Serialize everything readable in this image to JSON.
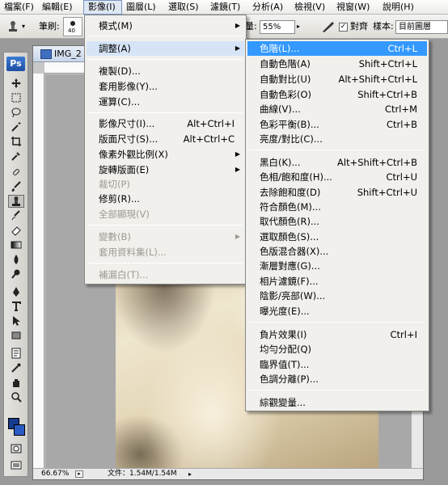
{
  "menubar": {
    "items": [
      {
        "label": "檔案(F)"
      },
      {
        "label": "編輯(E)"
      },
      {
        "label": "影像(I)"
      },
      {
        "label": "圖層(L)"
      },
      {
        "label": "選取(S)"
      },
      {
        "label": "濾鏡(T)"
      },
      {
        "label": "分析(A)"
      },
      {
        "label": "檢視(V)"
      },
      {
        "label": "視窗(W)"
      },
      {
        "label": "說明(H)"
      }
    ]
  },
  "options": {
    "brush_label": "筆刷:",
    "brush_size": "40",
    "flow_label": "流量:",
    "flow_value": "55%",
    "align_label": "對齊",
    "align_checked": "✓",
    "sample_label": "樣本:",
    "sample_value": "目前圖層"
  },
  "toolbox": {
    "logo": "Ps"
  },
  "document": {
    "title": "IMG_2",
    "zoom": "66.67%",
    "file_info": "文件：1.54M/1.54M"
  },
  "image_menu": {
    "items": [
      {
        "label": "模式(M)",
        "shortcut": "",
        "arrow": "▶"
      },
      {
        "label": "調整(A)",
        "shortcut": "",
        "arrow": "▶"
      },
      {
        "label": "複製(D)...",
        "shortcut": "",
        "arrow": ""
      },
      {
        "label": "套用影像(Y)...",
        "shortcut": "",
        "arrow": ""
      },
      {
        "label": "運算(C)...",
        "shortcut": "",
        "arrow": ""
      },
      {
        "label": "影像尺寸(I)...",
        "shortcut": "Alt+Ctrl+I",
        "arrow": ""
      },
      {
        "label": "版面尺寸(S)...",
        "shortcut": "Alt+Ctrl+C",
        "arrow": ""
      },
      {
        "label": "像素外觀比例(X)",
        "shortcut": "",
        "arrow": "▶"
      },
      {
        "label": "旋轉版面(E)",
        "shortcut": "",
        "arrow": "▶"
      },
      {
        "label": "裁切(P)",
        "shortcut": "",
        "arrow": ""
      },
      {
        "label": "修剪(R)...",
        "shortcut": "",
        "arrow": ""
      },
      {
        "label": "全部顯現(V)",
        "shortcut": "",
        "arrow": ""
      },
      {
        "label": "變數(B)",
        "shortcut": "",
        "arrow": "▶"
      },
      {
        "label": "套用資料集(L)...",
        "shortcut": "",
        "arrow": ""
      },
      {
        "label": "補漏白(T)...",
        "shortcut": "",
        "arrow": ""
      }
    ]
  },
  "adjust_menu": {
    "items": [
      {
        "label": "色階(L)...",
        "shortcut": "Ctrl+L"
      },
      {
        "label": "自動色階(A)",
        "shortcut": "Shift+Ctrl+L"
      },
      {
        "label": "自動對比(U)",
        "shortcut": "Alt+Shift+Ctrl+L"
      },
      {
        "label": "自動色彩(O)",
        "shortcut": "Shift+Ctrl+B"
      },
      {
        "label": "曲線(V)...",
        "shortcut": "Ctrl+M"
      },
      {
        "label": "色彩平衡(B)...",
        "shortcut": "Ctrl+B"
      },
      {
        "label": "亮度/對比(C)...",
        "shortcut": ""
      },
      {
        "label": "黑白(K)...",
        "shortcut": "Alt+Shift+Ctrl+B"
      },
      {
        "label": "色相/飽和度(H)...",
        "shortcut": "Ctrl+U"
      },
      {
        "label": "去除飽和度(D)",
        "shortcut": "Shift+Ctrl+U"
      },
      {
        "label": "符合顏色(M)...",
        "shortcut": ""
      },
      {
        "label": "取代顏色(R)...",
        "shortcut": ""
      },
      {
        "label": "選取顏色(S)...",
        "shortcut": ""
      },
      {
        "label": "色版混合器(X)...",
        "shortcut": ""
      },
      {
        "label": "漸層對應(G)...",
        "shortcut": ""
      },
      {
        "label": "相片濾鏡(F)...",
        "shortcut": ""
      },
      {
        "label": "陰影/亮部(W)...",
        "shortcut": ""
      },
      {
        "label": "曝光度(E)...",
        "shortcut": ""
      },
      {
        "label": "負片效果(I)",
        "shortcut": "Ctrl+I"
      },
      {
        "label": "均勻分配(Q)",
        "shortcut": ""
      },
      {
        "label": "臨界值(T)...",
        "shortcut": ""
      },
      {
        "label": "色調分離(P)...",
        "shortcut": ""
      },
      {
        "label": "綜觀變量...",
        "shortcut": ""
      }
    ]
  }
}
